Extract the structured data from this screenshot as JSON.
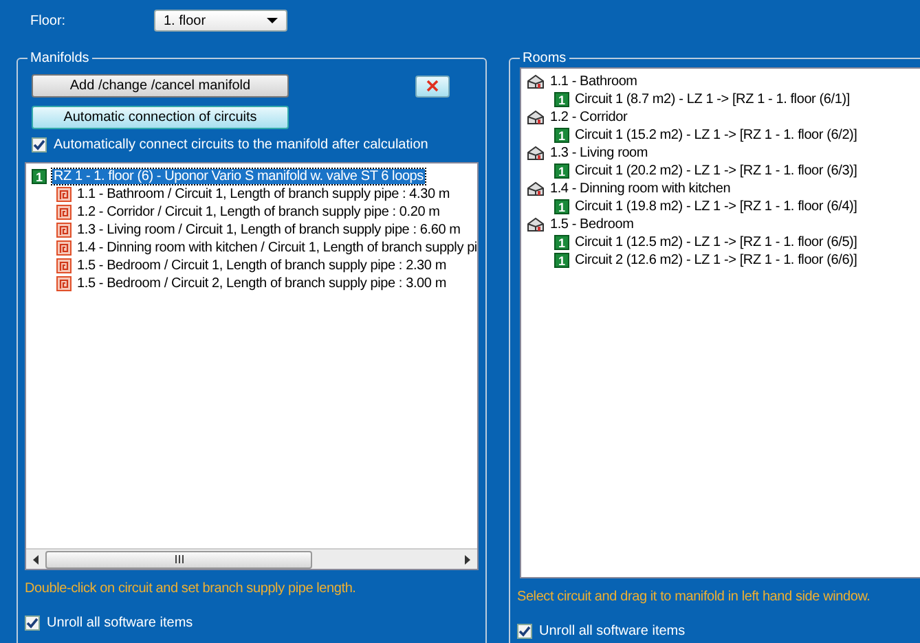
{
  "floor": {
    "label": "Floor:",
    "value": "1. floor"
  },
  "manifolds": {
    "title": "Manifolds",
    "buttons": [
      {
        "label": "Add /change /cancel manifold",
        "focused": false
      },
      {
        "label": "Automatic connection of circuits",
        "focused": true
      }
    ],
    "auto_connect": {
      "label": "Automatically connect circuits to the manifold after calculation",
      "checked": true
    },
    "tree": [
      {
        "badge": "1",
        "label": "RZ 1 - 1. floor (6)  -  Uponor Vario S manifold w. valve ST  6 loops",
        "selected": true,
        "children": [
          {
            "label": "1.1 - Bathroom / Circuit 1,  Length of branch supply pipe : 4.30 m",
            "selected": false
          },
          {
            "label": "1.2 - Corridor / Circuit 1,  Length of branch supply pipe : 0.20 m",
            "selected": false
          },
          {
            "label": "1.3 - Living room / Circuit 1,  Length of branch supply pipe : 6.60 m",
            "selected": false
          },
          {
            "label": "1.4 - Dinning room with kitchen / Circuit 1,  Length of branch supply pi",
            "selected": false
          },
          {
            "label": "1.5 - Bedroom / Circuit 1,  Length of branch supply pipe : 2.30 m",
            "selected": false
          },
          {
            "label": "1.5 - Bedroom / Circuit 2,  Length of branch supply pipe : 3.00 m",
            "selected": false
          }
        ]
      }
    ],
    "hint": "Double-click on circuit and set branch supply pipe length.",
    "unroll": {
      "label": "Unroll all software items",
      "checked": true
    }
  },
  "rooms": {
    "title": "Rooms",
    "tree": [
      {
        "label": "1.1 - Bathroom",
        "children": [
          {
            "badge": "1",
            "label": "Circuit 1 (8.7 m2) - LZ 1  -> [RZ 1 - 1. floor (6/1)]"
          }
        ]
      },
      {
        "label": "1.2 - Corridor",
        "children": [
          {
            "badge": "1",
            "label": "Circuit 1 (15.2 m2) - LZ 1  -> [RZ 1 - 1. floor (6/2)]"
          }
        ]
      },
      {
        "label": "1.3 - Living room",
        "children": [
          {
            "badge": "1",
            "label": "Circuit 1 (20.2 m2) - LZ 1  -> [RZ 1 - 1. floor (6/3)]"
          }
        ]
      },
      {
        "label": "1.4 - Dinning room with kitchen",
        "children": [
          {
            "badge": "1",
            "label": "Circuit 1 (19.8 m2) - LZ 1  -> [RZ 1 - 1. floor (6/4)]"
          }
        ]
      },
      {
        "label": "1.5 - Bedroom",
        "children": [
          {
            "badge": "1",
            "label": "Circuit 1 (12.5 m2) - LZ 1  -> [RZ 1 - 1. floor (6/5)]"
          },
          {
            "badge": "1",
            "label": "Circuit 2 (12.6 m2) - LZ 1  -> [RZ 1 - 1. floor (6/6)]"
          }
        ]
      }
    ],
    "hint": "Select circuit and drag it to manifold in left hand side window.",
    "unroll": {
      "label": "Unroll all software items",
      "checked": true
    }
  }
}
